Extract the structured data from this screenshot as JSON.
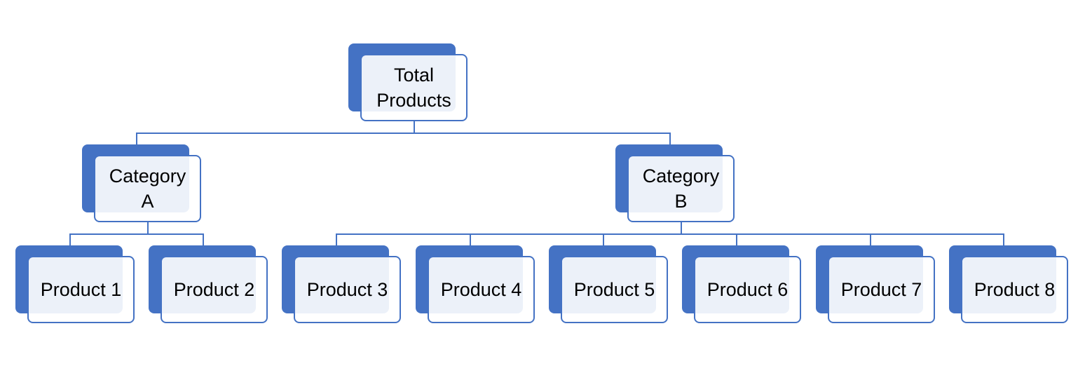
{
  "diagram": {
    "type": "org-chart",
    "accent_color": "#4472C4",
    "root": {
      "label": "Total Products"
    },
    "categories": [
      {
        "label": "Category A",
        "products": [
          {
            "label": "Product 1"
          },
          {
            "label": "Product 2"
          }
        ]
      },
      {
        "label": "Category B",
        "products": [
          {
            "label": "Product 3"
          },
          {
            "label": "Product 4"
          },
          {
            "label": "Product 5"
          },
          {
            "label": "Product 6"
          },
          {
            "label": "Product 7"
          },
          {
            "label": "Product 8"
          }
        ]
      }
    ]
  }
}
